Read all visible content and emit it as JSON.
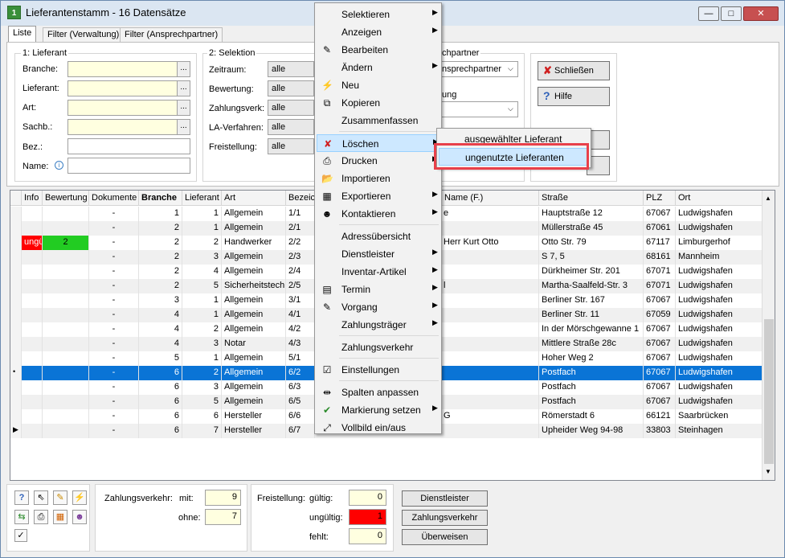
{
  "window": {
    "title": "Lieferantenstamm - 16 Datensätze",
    "app_icon_text": "1",
    "minimize": "—",
    "maximize": "□",
    "close": "✕"
  },
  "tabs": [
    {
      "label": "Liste"
    },
    {
      "label": "Filter (Verwaltung)"
    },
    {
      "label": "Filter (Ansprechpartner)"
    }
  ],
  "lieferant": {
    "title": "1: Lieferant",
    "branche": "Branche:",
    "lieferant": "Lieferant:",
    "art": "Art:",
    "sachb": "Sachb.:",
    "bez": "Bez.:",
    "name": "Name:",
    "dots": "..."
  },
  "selektion": {
    "title": "2: Selektion",
    "zeitraum": "Zeitraum:",
    "bewertung": "Bewertung:",
    "zahlungsverk": "Zahlungsverk:",
    "la_verfahren": "LA-Verfahren:",
    "freistellung": "Freistellung:",
    "value": "alle"
  },
  "ansprech": {
    "title": "chpartner",
    "combo1": "nsprechpartner",
    "title2": "ung"
  },
  "buttons": {
    "schliessen": "Schließen",
    "hilfe": "Hilfe"
  },
  "grid": {
    "headers": [
      "Info",
      "Bewertung",
      "Dokumente",
      "Branche",
      "Lieferant",
      "Art",
      "Bezeic",
      "Name (F.)",
      "Straße",
      "PLZ",
      "Ort"
    ],
    "rows": [
      {
        "marker": "",
        "info": "",
        "bew": "",
        "dok": "-",
        "br": "1",
        "lf": "1",
        "art": "Allgemein",
        "bez": "1/1",
        "name": "e",
        "str": "Hauptstraße 12",
        "plz": "67067",
        "ort": "Ludwigshafen"
      },
      {
        "marker": "",
        "info": "",
        "bew": "",
        "dok": "-",
        "br": "2",
        "lf": "1",
        "art": "Allgemein",
        "bez": "2/1",
        "name": "",
        "str": "Müllerstraße 45",
        "plz": "67061",
        "ort": "Ludwigshafen"
      },
      {
        "marker": "",
        "info": "ungü",
        "bew": "2",
        "dok": "-",
        "br": "2",
        "lf": "2",
        "art": "Handwerker",
        "bez": "2/2",
        "name": "Herr Kurt Otto",
        "str": "Otto Str. 79",
        "plz": "67117",
        "ort": "Limburgerhof"
      },
      {
        "marker": "",
        "info": "",
        "bew": "",
        "dok": "-",
        "br": "2",
        "lf": "3",
        "art": "Allgemein",
        "bez": "2/3",
        "name": "",
        "str": "S 7, 5",
        "plz": "68161",
        "ort": "Mannheim"
      },
      {
        "marker": "",
        "info": "",
        "bew": "",
        "dok": "-",
        "br": "2",
        "lf": "4",
        "art": "Allgemein",
        "bez": "2/4",
        "name": "",
        "str": "Dürkheimer Str. 201",
        "plz": "67071",
        "ort": "Ludwigshafen"
      },
      {
        "marker": "",
        "info": "",
        "bew": "",
        "dok": "-",
        "br": "2",
        "lf": "5",
        "art": "Sicherheitstechr",
        "bez": "2/5",
        "name": "l",
        "str": "Martha-Saalfeld-Str. 3",
        "plz": "67071",
        "ort": "Ludwigshafen"
      },
      {
        "marker": "",
        "info": "",
        "bew": "",
        "dok": "-",
        "br": "3",
        "lf": "1",
        "art": "Allgemein",
        "bez": "3/1",
        "name": "",
        "str": "Berliner Str. 167",
        "plz": "67067",
        "ort": "Ludwigshafen"
      },
      {
        "marker": "",
        "info": "",
        "bew": "",
        "dok": "-",
        "br": "4",
        "lf": "1",
        "art": "Allgemein",
        "bez": "4/1",
        "name": "",
        "str": "Berliner Str. 11",
        "plz": "67059",
        "ort": "Ludwigshafen"
      },
      {
        "marker": "",
        "info": "",
        "bew": "",
        "dok": "-",
        "br": "4",
        "lf": "2",
        "art": "Allgemein",
        "bez": "4/2",
        "name": "",
        "str": "In der Mörschgewanne 1",
        "plz": "67067",
        "ort": "Ludwigshafen"
      },
      {
        "marker": "",
        "info": "",
        "bew": "",
        "dok": "-",
        "br": "4",
        "lf": "3",
        "art": "Notar",
        "bez": "4/3",
        "name": "",
        "str": "Mittlere Straße 28c",
        "plz": "67067",
        "ort": "Ludwigshafen"
      },
      {
        "marker": "",
        "info": "",
        "bew": "",
        "dok": "-",
        "br": "5",
        "lf": "1",
        "art": "Allgemein",
        "bez": "5/1",
        "name": "",
        "str": "Hoher Weg 2",
        "plz": "67067",
        "ort": "Ludwigshafen"
      },
      {
        "marker": "•",
        "info": "",
        "bew": "",
        "dok": "-",
        "br": "6",
        "lf": "2",
        "art": "Allgemein",
        "bez": "6/2",
        "name": "",
        "str": "Postfach",
        "plz": "67067",
        "ort": "Ludwigshafen"
      },
      {
        "marker": "",
        "info": "",
        "bew": "",
        "dok": "-",
        "br": "6",
        "lf": "3",
        "art": "Allgemein",
        "bez": "6/3",
        "name": "",
        "str": "Postfach",
        "plz": "67067",
        "ort": "Ludwigshafen"
      },
      {
        "marker": "",
        "info": "",
        "bew": "",
        "dok": "-",
        "br": "6",
        "lf": "5",
        "art": "Allgemein",
        "bez": "6/5",
        "name": "",
        "str": "Postfach",
        "plz": "67067",
        "ort": "Ludwigshafen"
      },
      {
        "marker": "",
        "info": "",
        "bew": "",
        "dok": "-",
        "br": "6",
        "lf": "6",
        "art": "Hersteller",
        "bez": "6/6",
        "name": "G",
        "str": "Römerstadt 6",
        "plz": "66121",
        "ort": "Saarbrücken"
      },
      {
        "marker": "▶",
        "info": "",
        "bew": "",
        "dok": "-",
        "br": "6",
        "lf": "7",
        "art": "Hersteller",
        "bez": "6/7",
        "name": "",
        "str": "Upheider Weg 94-98",
        "plz": "33803",
        "ort": "Steinhagen"
      }
    ]
  },
  "menu": {
    "items": [
      {
        "label": "Selektieren",
        "icon": "",
        "arrow": "▶"
      },
      {
        "label": "Anzeigen",
        "icon": "",
        "arrow": "▶"
      },
      {
        "label": "Bearbeiten",
        "icon": "✎",
        "arrow": ""
      },
      {
        "label": "Ändern",
        "icon": "",
        "arrow": "▶"
      },
      {
        "label": "Neu",
        "icon": "⚡",
        "arrow": ""
      },
      {
        "label": "Kopieren",
        "icon": "⧉",
        "arrow": ""
      },
      {
        "label": "Zusammenfassen",
        "icon": "",
        "arrow": ""
      },
      {
        "label": "Löschen",
        "icon": "✘",
        "arrow": "▶"
      },
      {
        "label": "Drucken",
        "icon": "⎙",
        "arrow": "▶"
      },
      {
        "label": "Importieren",
        "icon": "📂",
        "arrow": ""
      },
      {
        "label": "Exportieren",
        "icon": "▦",
        "arrow": "▶"
      },
      {
        "label": "Kontaktieren",
        "icon": "☻",
        "arrow": "▶"
      },
      {
        "label": "Adressübersicht",
        "icon": "",
        "arrow": ""
      },
      {
        "label": "Dienstleister",
        "icon": "",
        "arrow": "▶"
      },
      {
        "label": "Inventar-Artikel",
        "icon": "",
        "arrow": "▶"
      },
      {
        "label": "Termin",
        "icon": "▤",
        "arrow": "▶"
      },
      {
        "label": "Vorgang",
        "icon": "✎",
        "arrow": "▶"
      },
      {
        "label": "Zahlungsträger",
        "icon": "",
        "arrow": "▶"
      },
      {
        "label": "Zahlungsverkehr",
        "icon": "",
        "arrow": ""
      },
      {
        "label": "Einstellungen",
        "icon": "☑",
        "arrow": ""
      },
      {
        "label": "Spalten anpassen",
        "icon": "⇹",
        "arrow": ""
      },
      {
        "label": "Markierung setzen",
        "icon": "✔",
        "arrow": "▶"
      },
      {
        "label": "Vollbild ein/aus",
        "icon": "⤢",
        "arrow": ""
      }
    ]
  },
  "submenu": {
    "items": [
      "ausgewählter Lieferant",
      "ungenutzte Lieferanten"
    ]
  },
  "bottom": {
    "zv_label": "Zahlungsverkehr:",
    "mit": "mit:",
    "mit_val": "9",
    "ohne": "ohne:",
    "ohne_val": "7",
    "fs_label": "Freistellung:",
    "gueltig": "gültig:",
    "gueltig_val": "0",
    "ungueltig": "ungültig:",
    "ungueltig_val": "1",
    "fehlt": "fehlt:",
    "fehlt_val": "0",
    "btn_dienst": "Dienstleister",
    "btn_zv": "Zahlungsverkehr",
    "btn_ueber": "Überweisen"
  },
  "colors": {
    "selected_row": "#0a74d6",
    "invalid_red": "#ff0000",
    "rating_green": "#22cc22",
    "highlight_box": "#e8404a"
  }
}
